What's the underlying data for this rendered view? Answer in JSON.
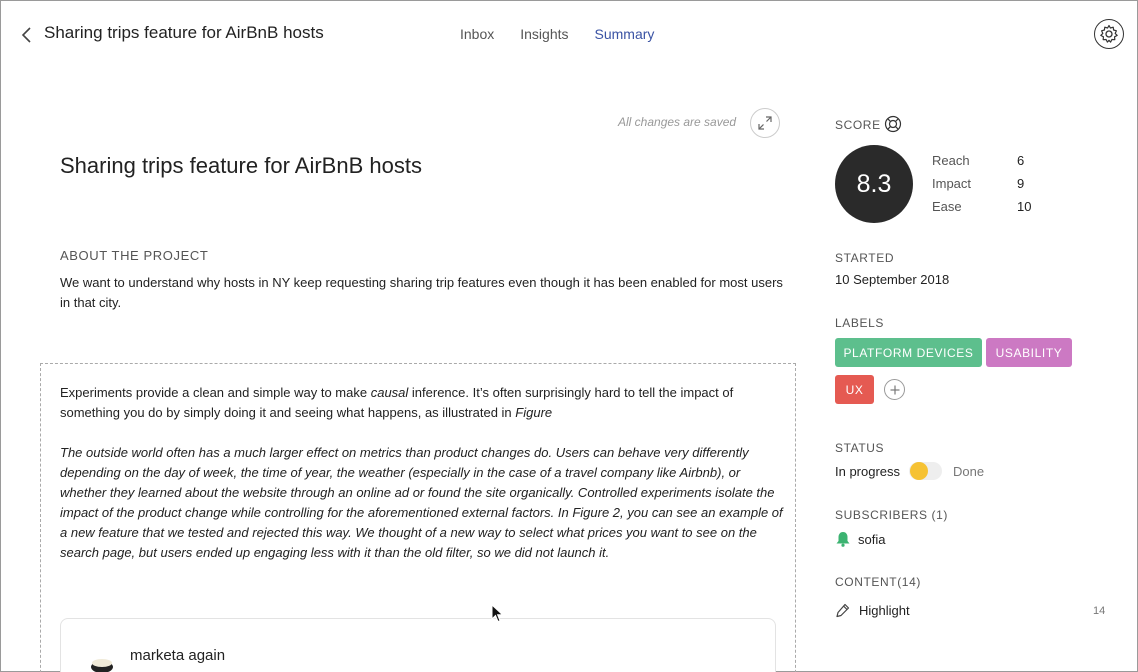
{
  "header": {
    "title": "Sharing trips feature for AirBnB hosts",
    "tabs": [
      "Inbox",
      "Insights",
      "Summary"
    ],
    "active_tab": "Summary"
  },
  "editor": {
    "saved_status": "All changes are saved",
    "title": "Sharing trips feature for AirBnB hosts",
    "about_heading": "ABOUT THE PROJECT",
    "about_text": "We want to understand why hosts in NY keep requesting sharing trip features even though it has been enabled for most users in that city.",
    "para1_before": "Experiments provide a clean and simple way to make ",
    "para1_em": "causal",
    "para1_mid": " inference. It’s often surprisingly hard to tell the impact of something you do by simply doing it and seeing what happens, as illustrated in ",
    "para1_fig": "Figure",
    "para2": "The outside world often has a much larger effect on metrics than product changes do. Users can behave very differently depending on the day of week, the time of year, the weather (especially in the case of a travel company like Airbnb), or whether they learned about the website through an online ad or found the site organically. Controlled experiments isolate the impact of the product change while controlling for the aforementioned external factors. In Figure 2, you can see an example of a new feature that we tested and rejected this way. We thought of a new way to select what prices you want to see on the search page, but users ended up engaging less with it than the old filter, so we did not launch it.",
    "card_name": "marketa again"
  },
  "sidebar": {
    "score_label": "SCORE",
    "score": "8.3",
    "metrics": [
      {
        "name": "Reach",
        "value": "6"
      },
      {
        "name": "Impact",
        "value": "9"
      },
      {
        "name": "Ease",
        "value": "10"
      }
    ],
    "started_label": "STARTED",
    "started_value": "10 September 2018",
    "labels_label": "LABELS",
    "labels": [
      {
        "text": "PLATFORM DEVICES",
        "color": "#5dbf8d"
      },
      {
        "text": "USABILITY",
        "color": "#cc79c3"
      },
      {
        "text": "UX",
        "color": "#e55a52"
      }
    ],
    "status_label": "STATUS",
    "status_in_progress": "In progress",
    "status_done": "Done",
    "subscribers_label": "SUBSCRIBERS (1)",
    "subscriber": "sofia",
    "content_label": "CONTENT(14)",
    "content_item": "Highlight",
    "content_count": "14"
  },
  "colors": {
    "active_tab": "#3a53a4",
    "score_bg": "#2a2a2a",
    "toggle_knob": "#f6c233",
    "bell": "#3cb371"
  }
}
